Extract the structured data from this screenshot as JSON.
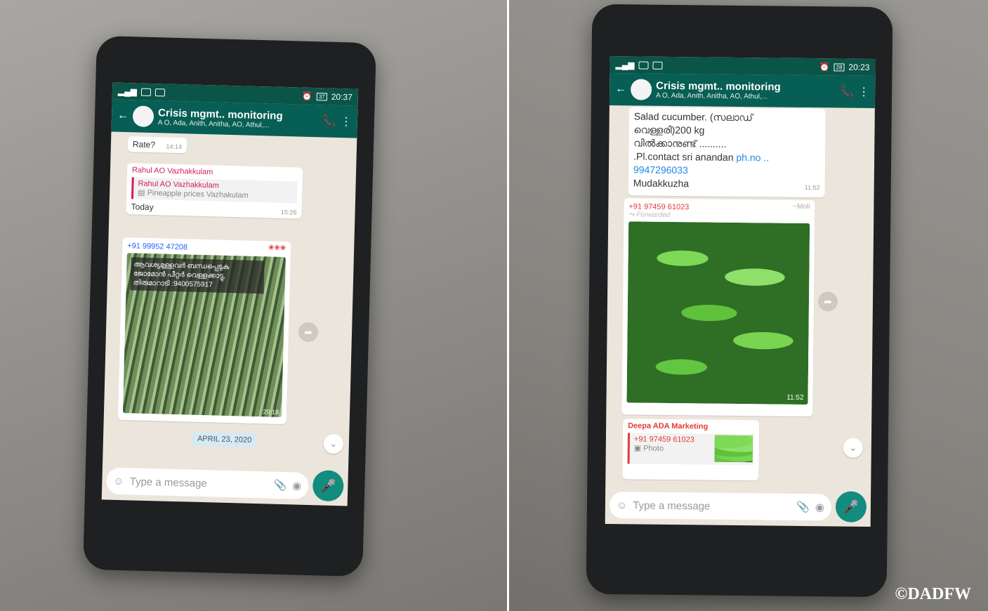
{
  "watermark": "©DADFW",
  "left": {
    "status": {
      "time": "20:37",
      "battery": "37"
    },
    "header": {
      "title": "Crisis mgmt.. monitoring",
      "subtitle": "A O, Ada, Anith, Anitha, AO, Athul,..."
    },
    "messages": {
      "rate_text": "Rate?",
      "rate_time": "14:14",
      "reply_sender": "Rahul AO Vazhakkulam",
      "reply_quote_sender": "Rahul AO Vazhakkulam",
      "reply_quote_text": "Pineapple prices Vazhakulam",
      "reply_text": "Today",
      "reply_time": "15:26",
      "photo_sender": "+91 99952 47208",
      "photo_caption_l1": "ആവശ്യമുള്ളവർ ബന്ധപ്പെടുക",
      "photo_caption_l2": "ജോമോൻ പീറ്റർ വെള്ളക്കാട്ടു,",
      "photo_caption_l3": "തിരുമാറാടി :9400575917",
      "photo_time": "20:18",
      "date_chip": "APRIL 23, 2020"
    },
    "input": {
      "placeholder": "Type a message"
    }
  },
  "right": {
    "status": {
      "time": "20:23",
      "battery": "28"
    },
    "header": {
      "title": "Crisis mgmt.. monitoring",
      "subtitle": "A O, Ada, Anith, Anitha, AO, Athul,..."
    },
    "messages": {
      "text_l1": "Salad cucumber. (സലാഡ്",
      "text_l2": "വെള്ളരി)200 kg",
      "text_l3": "വിൽക്കാനുണ്ട് ..........",
      "text_l4": ".Pl.contact sri anandan",
      "text_link1": "ph.no ..",
      "text_link2": "9947296033",
      "text_l5": "Mudakkuzha",
      "text_time": "11:52",
      "photo_sender": "+91 97459 61023",
      "photo_sender_name": "~Moli",
      "photo_forwarded": "Forwarded",
      "photo_time": "11:52",
      "reply_sender": "Deepa ADA Marketing",
      "reply_quote_sender": "+91 97459 61023",
      "reply_quote_text": "Photo"
    },
    "input": {
      "placeholder": "Type a message"
    }
  }
}
